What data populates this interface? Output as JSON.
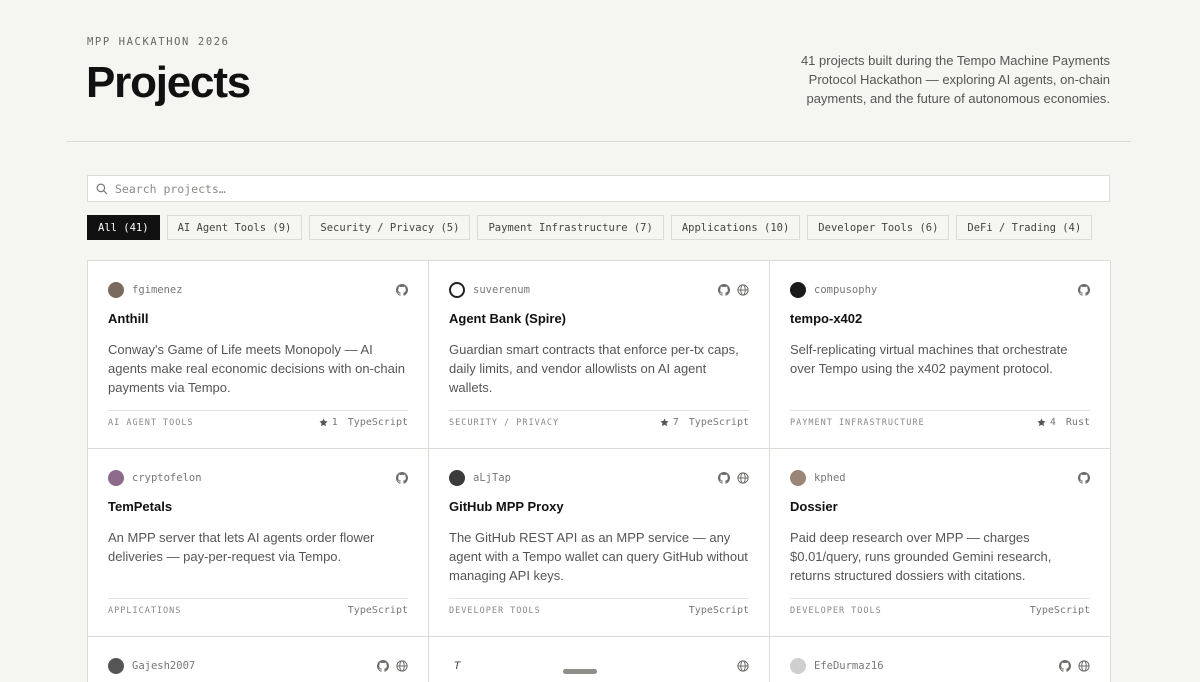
{
  "header": {
    "eyebrow": "MPP HACKATHON 2026",
    "title": "Projects",
    "intro": "41 projects built during the Tempo Machine Payments Protocol Hackathon — exploring AI agents, on-chain payments, and the future of autonomous economies."
  },
  "search": {
    "placeholder": "Search projects…",
    "icon": "search-icon"
  },
  "filters": [
    {
      "label": "All (41)",
      "active": true
    },
    {
      "label": "AI Agent Tools (9)",
      "active": false
    },
    {
      "label": "Security / Privacy (5)",
      "active": false
    },
    {
      "label": "Payment Infrastructure (7)",
      "active": false
    },
    {
      "label": "Applications (10)",
      "active": false
    },
    {
      "label": "Developer Tools (6)",
      "active": false
    },
    {
      "label": "DeFi / Trading (4)",
      "active": false
    }
  ],
  "projects": [
    {
      "author": "fgimenez",
      "name": "Anthill",
      "description": "Conway's Game of Life meets Monopoly — AI agents make real economic decisions with on-chain payments via Tempo.",
      "category": "AI AGENT TOOLS",
      "stars": "1",
      "language": "TypeScript",
      "links": [
        "github-icon"
      ]
    },
    {
      "author": "suverenum",
      "name": "Agent Bank (Spire)",
      "description": "Guardian smart contracts that enforce per-tx caps, daily limits, and vendor allowlists on AI agent wallets.",
      "category": "SECURITY / PRIVACY",
      "stars": "7",
      "language": "TypeScript",
      "links": [
        "github-icon",
        "globe-icon"
      ]
    },
    {
      "author": "compusophy",
      "name": "tempo-x402",
      "description": "Self-replicating virtual machines that orchestrate over Tempo using the x402 payment protocol.",
      "category": "PAYMENT INFRASTRUCTURE",
      "stars": "4",
      "language": "Rust",
      "links": [
        "github-icon"
      ]
    },
    {
      "author": "cryptofelon",
      "name": "TemPetals",
      "description": "An MPP server that lets AI agents order flower deliveries — pay-per-request via Tempo.",
      "category": "APPLICATIONS",
      "stars": "",
      "language": "TypeScript",
      "links": [
        "github-icon"
      ]
    },
    {
      "author": "aLjTap",
      "name": "GitHub MPP Proxy",
      "description": "The GitHub REST API as an MPP service — any agent with a Tempo wallet can query GitHub without managing API keys.",
      "category": "DEVELOPER TOOLS",
      "stars": "",
      "language": "TypeScript",
      "links": [
        "github-icon",
        "globe-icon"
      ]
    },
    {
      "author": "kphed",
      "name": "Dossier",
      "description": "Paid deep research over MPP — charges $0.01/query, runs grounded Gemini research, returns structured dossiers with citations.",
      "category": "DEVELOPER TOOLS",
      "stars": "",
      "language": "TypeScript",
      "links": [
        "github-icon"
      ]
    },
    {
      "author": "Gajesh2007",
      "links": [
        "github-icon",
        "globe-icon"
      ]
    },
    {
      "author": "",
      "avatar_glyph": "T",
      "links": [
        "globe-icon"
      ]
    },
    {
      "author": "EfeDurmaz16",
      "links": [
        "github-icon",
        "globe-icon"
      ]
    }
  ]
}
